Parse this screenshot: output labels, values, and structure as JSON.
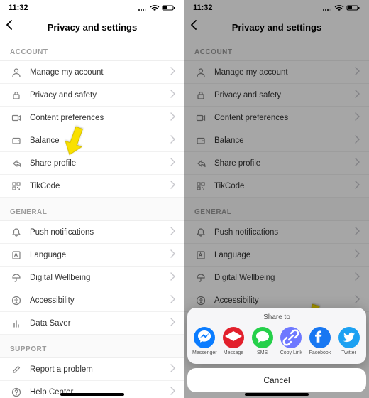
{
  "status": {
    "time": "11:32"
  },
  "header": {
    "title": "Privacy and settings"
  },
  "sections": {
    "account": {
      "label": "ACCOUNT",
      "items": [
        {
          "label": "Manage my account"
        },
        {
          "label": "Privacy and safety"
        },
        {
          "label": "Content preferences"
        },
        {
          "label": "Balance"
        },
        {
          "label": "Share profile"
        },
        {
          "label": "TikCode"
        }
      ]
    },
    "general": {
      "label": "GENERAL",
      "items": [
        {
          "label": "Push notifications"
        },
        {
          "label": "Language"
        },
        {
          "label": "Digital Wellbeing"
        },
        {
          "label": "Accessibility"
        },
        {
          "label": "Data Saver"
        }
      ]
    },
    "support": {
      "label": "SUPPORT",
      "items": [
        {
          "label": "Report a problem"
        },
        {
          "label": "Help Center"
        }
      ]
    }
  },
  "share_sheet": {
    "title": "Share to",
    "cancel": "Cancel",
    "apps": [
      {
        "name": "Messenger",
        "color": "#0a7cff"
      },
      {
        "name": "Message",
        "color": "#e2202c"
      },
      {
        "name": "SMS",
        "color": "#25d04a"
      },
      {
        "name": "Copy Link",
        "color": "#6e78ff"
      },
      {
        "name": "Facebook",
        "color": "#1877f2"
      },
      {
        "name": "Twitter",
        "color": "#1da1f2"
      }
    ]
  }
}
